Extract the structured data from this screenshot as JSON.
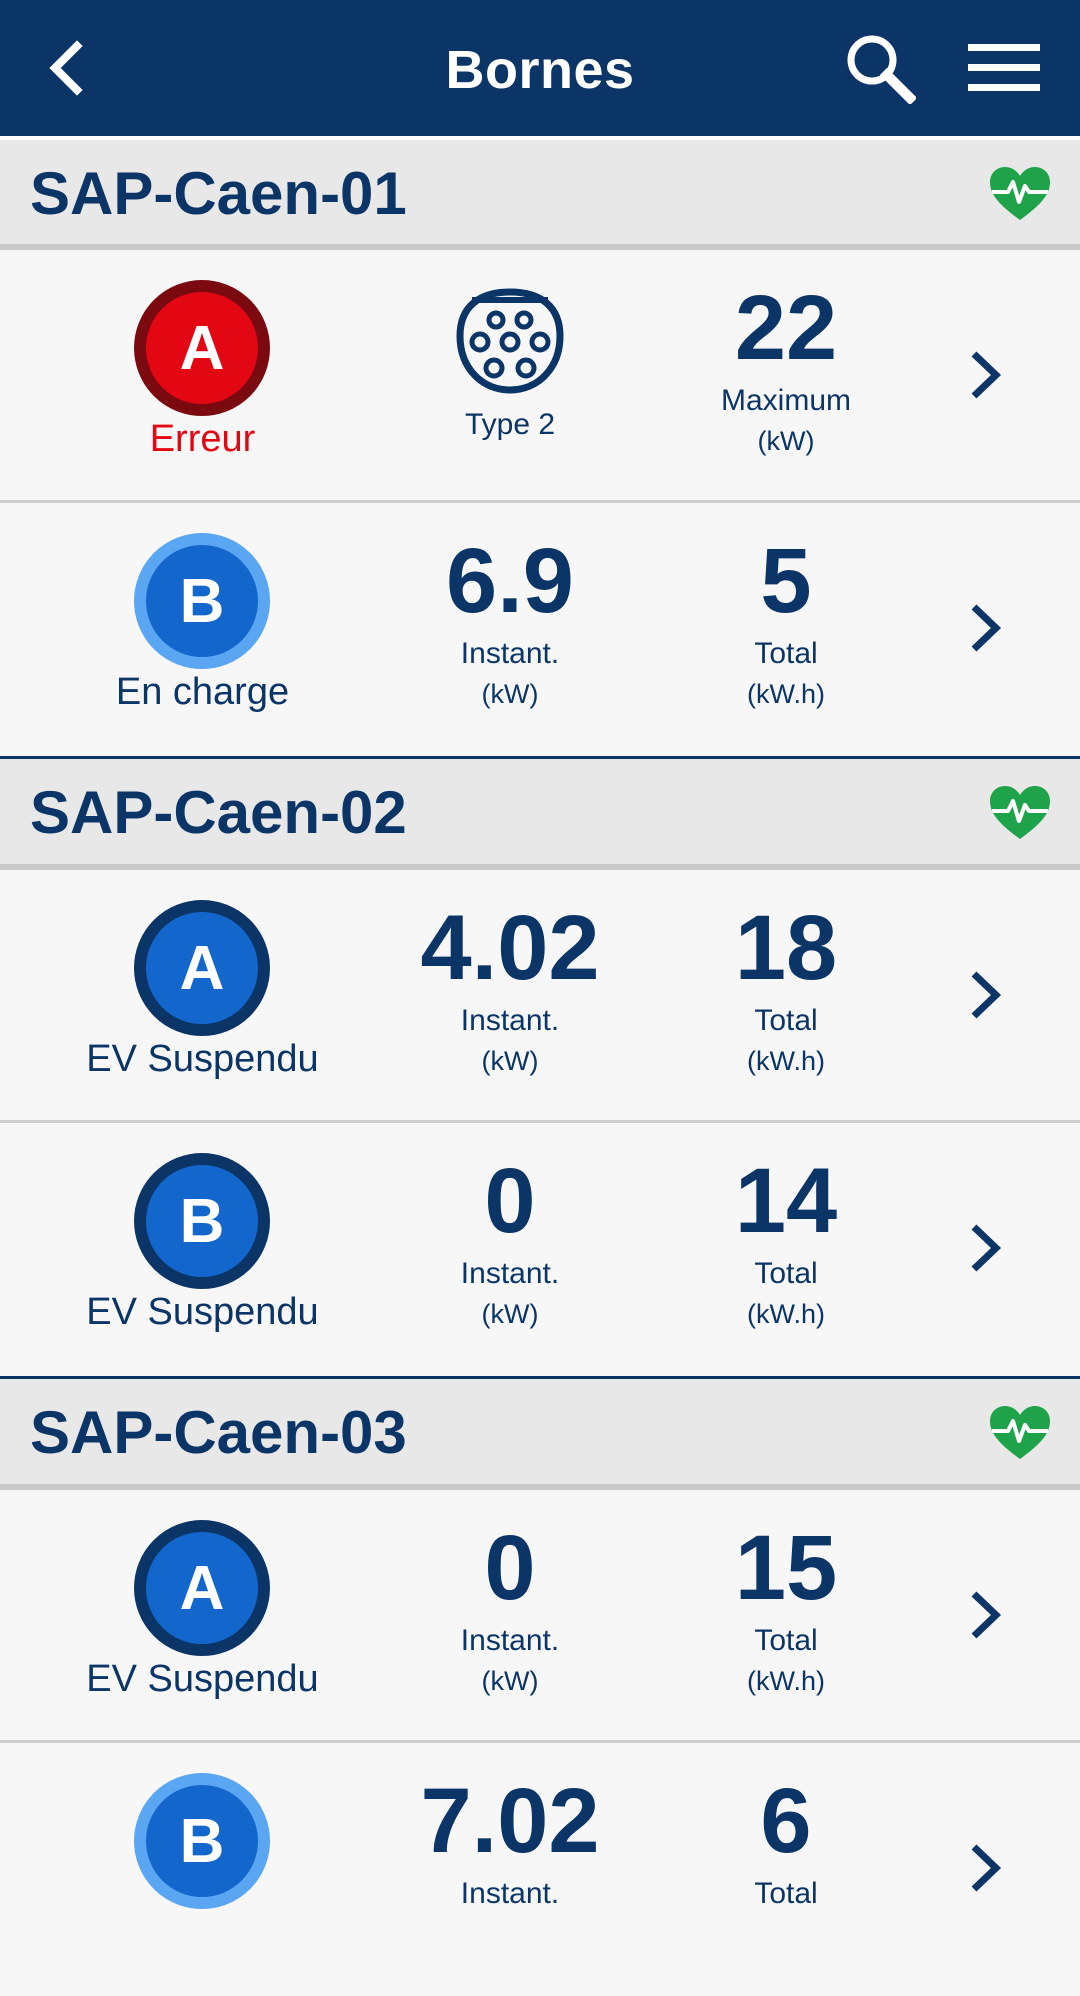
{
  "header": {
    "title": "Bornes",
    "back_icon": "back-chevron-icon",
    "search_icon": "search-icon",
    "menu_icon": "menu-icon"
  },
  "colors": {
    "primary": "#0b3566",
    "error_fill": "#e30613",
    "error_ring": "#7a0a10",
    "charging_fill": "#1366cc",
    "charging_ring": "#5aa6f2",
    "suspended_fill": "#1366cc",
    "suspended_ring": "#0b3566",
    "health": "#1fa34a"
  },
  "stations": [
    {
      "name": "SAP-Caen-01",
      "health_icon": "heart-pulse-icon",
      "connectors": [
        {
          "letter": "A",
          "status": "Erreur",
          "state": "error",
          "type_label": "Type 2",
          "type_icon": "type2-plug-icon",
          "value": "22",
          "value_label": "Maximum",
          "value_unit": "(kW)"
        },
        {
          "letter": "B",
          "status": "En charge",
          "state": "charging",
          "instant": "6.9",
          "instant_label": "Instant.",
          "instant_unit": "(kW)",
          "total": "5",
          "total_label": "Total",
          "total_unit": "(kW.h)"
        }
      ]
    },
    {
      "name": "SAP-Caen-02",
      "health_icon": "heart-pulse-icon",
      "connectors": [
        {
          "letter": "A",
          "status": "EV Suspendu",
          "state": "suspended",
          "instant": "4.02",
          "instant_label": "Instant.",
          "instant_unit": "(kW)",
          "total": "18",
          "total_label": "Total",
          "total_unit": "(kW.h)"
        },
        {
          "letter": "B",
          "status": "EV Suspendu",
          "state": "suspended",
          "instant": "0",
          "instant_label": "Instant.",
          "instant_unit": "(kW)",
          "total": "14",
          "total_label": "Total",
          "total_unit": "(kW.h)"
        }
      ]
    },
    {
      "name": "SAP-Caen-03",
      "health_icon": "heart-pulse-icon",
      "connectors": [
        {
          "letter": "A",
          "status": "EV Suspendu",
          "state": "suspended",
          "instant": "0",
          "instant_label": "Instant.",
          "instant_unit": "(kW)",
          "total": "15",
          "total_label": "Total",
          "total_unit": "(kW.h)"
        },
        {
          "letter": "B",
          "status": "",
          "state": "charging",
          "instant": "7.02",
          "instant_label": "Instant.",
          "instant_unit": "",
          "total": "6",
          "total_label": "Total",
          "total_unit": ""
        }
      ]
    }
  ]
}
